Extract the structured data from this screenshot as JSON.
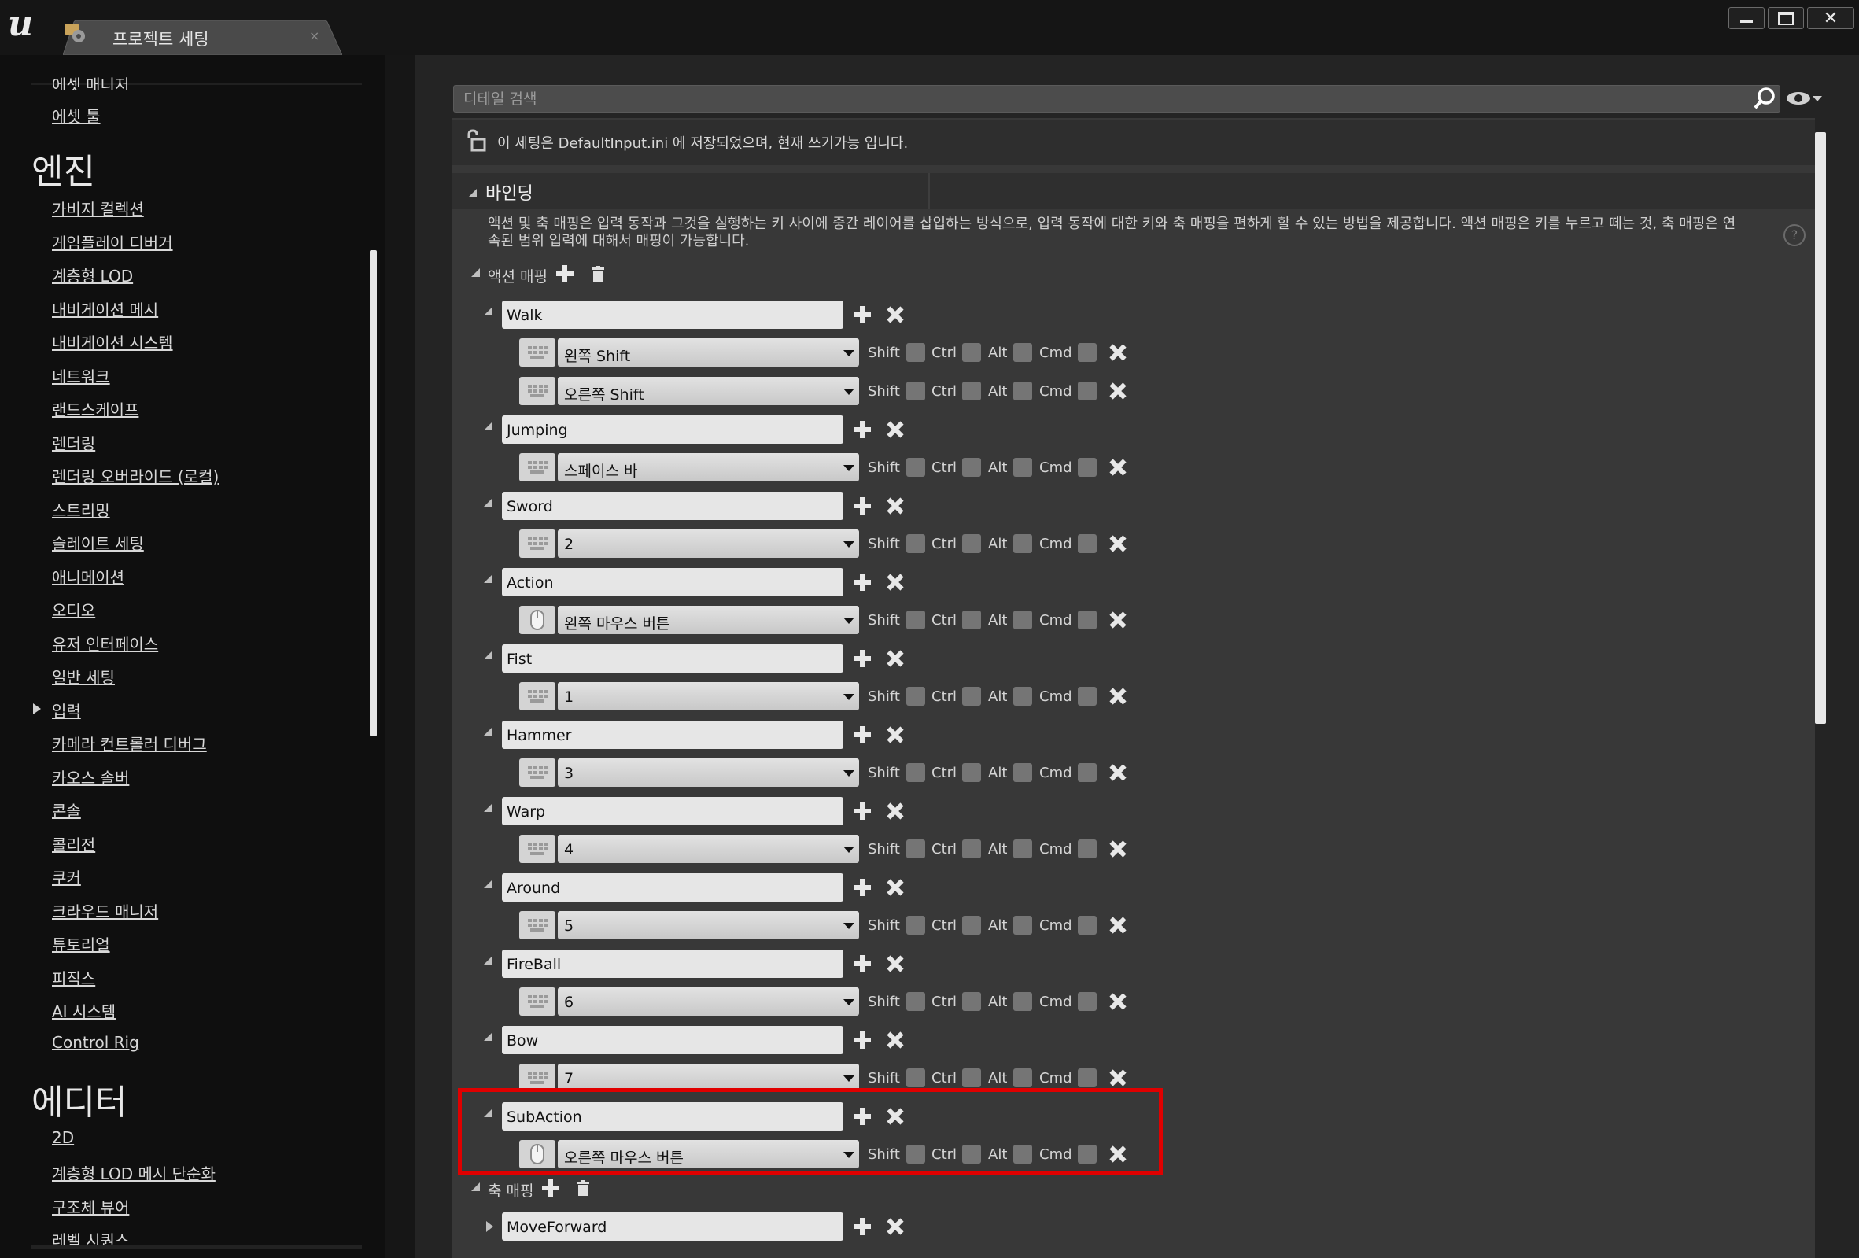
{
  "titlebar": {
    "tab_label": "프로젝트 세팅",
    "tab_close": "×"
  },
  "sidebar": {
    "cut_top_item": "에셋 매니저",
    "item_asset_tools": "에셋 툴",
    "engine_header": "엔진",
    "engine_items": [
      "가비지 컬렉션",
      "게임플레이 디버거",
      "계층형 LOD",
      "내비게이션 메시",
      "내비게이션 시스템",
      "네트워크",
      "랜드스케이프",
      "렌더링",
      "렌더링 오버라이드 (로컬)",
      "스트리밍",
      "슬레이트 세팅",
      "애니메이션",
      "오디오",
      "유저 인터페이스",
      "일반 세팅",
      "입력",
      "카메라 컨트롤러 디버그",
      "카오스 솔버",
      "콘솔",
      "콜리전",
      "쿠커",
      "크라우드 매니저",
      "튜토리얼",
      "피직스",
      "AI 시스템",
      "Control Rig"
    ],
    "editor_header": "에디터",
    "editor_items": [
      "2D",
      "계층형 LOD 메시 단순화",
      "구조체 뷰어",
      "레벨 시퀀스"
    ]
  },
  "search": {
    "placeholder": "디테일 검색"
  },
  "notice": {
    "text": "이 세팅은 DefaultInput.ini 에 저장되었으며, 현재 쓰기가능 입니다."
  },
  "bindings": {
    "title": "바인딩",
    "description": "액션 및 축 매핑은 입력 동작과 그것을 실행하는 키 사이에 중간 레이어를 삽입하는 방식으로, 입력 동작에 대한 키와 축 매핑을 편하게 할 수 있는 방법을 제공합니다. 액션 매핑은 키를 누르고 떼는 것, 축 매핑은 연속된 범위 입력에 대해서 매핑이 가능합니다.",
    "action_mappings_label": "액션 매핑",
    "axis_mappings_label": "축 매핑",
    "modifiers": [
      "Shift",
      "Ctrl",
      "Alt",
      "Cmd"
    ],
    "actions": [
      {
        "name": "Walk",
        "keys": [
          {
            "key": "왼쪽 Shift",
            "device": "keyboard"
          },
          {
            "key": "오른쪽 Shift",
            "device": "keyboard"
          }
        ]
      },
      {
        "name": "Jumping",
        "keys": [
          {
            "key": "스페이스 바",
            "device": "keyboard"
          }
        ]
      },
      {
        "name": "Sword",
        "keys": [
          {
            "key": "2",
            "device": "keyboard"
          }
        ]
      },
      {
        "name": "Action",
        "keys": [
          {
            "key": "왼쪽 마우스 버튼",
            "device": "mouse"
          }
        ]
      },
      {
        "name": "Fist",
        "keys": [
          {
            "key": "1",
            "device": "keyboard"
          }
        ]
      },
      {
        "name": "Hammer",
        "keys": [
          {
            "key": "3",
            "device": "keyboard"
          }
        ]
      },
      {
        "name": "Warp",
        "keys": [
          {
            "key": "4",
            "device": "keyboard"
          }
        ]
      },
      {
        "name": "Around",
        "keys": [
          {
            "key": "5",
            "device": "keyboard"
          }
        ]
      },
      {
        "name": "FireBall",
        "keys": [
          {
            "key": "6",
            "device": "keyboard"
          }
        ]
      },
      {
        "name": "Bow",
        "keys": [
          {
            "key": "7",
            "device": "keyboard"
          }
        ]
      },
      {
        "name": "SubAction",
        "keys": [
          {
            "key": "오른쪽 마우스 버튼",
            "device": "mouse"
          }
        ],
        "highlighted": true
      }
    ],
    "axes": [
      {
        "name": "MoveForward"
      }
    ]
  },
  "colors": {
    "highlight": "#e00000",
    "panel_bg": "#383838",
    "field_bg": "#e6e6e6"
  }
}
